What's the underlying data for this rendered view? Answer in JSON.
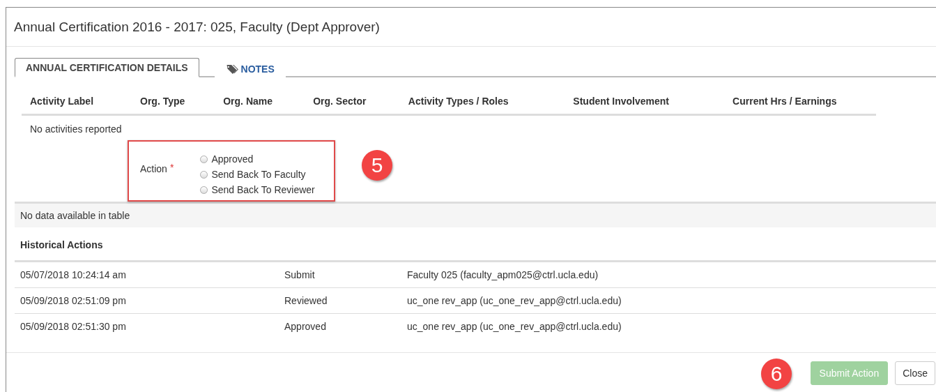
{
  "modal": {
    "title": "Annual Certification 2016 - 2017: 025, Faculty (Dept Approver)"
  },
  "tabs": [
    {
      "label": "ANNUAL CERTIFICATION DETAILS",
      "selected": true
    },
    {
      "label": "NOTES",
      "selected": false
    }
  ],
  "activities_table": {
    "columns": [
      "Activity Label",
      "Org. Type",
      "Org. Name",
      "Org. Sector",
      "Activity Types / Roles",
      "Student Involvement",
      "Current Hrs / Earnings"
    ],
    "empty_message": "No activities reported"
  },
  "action_form": {
    "label": "Action",
    "required_mark": "*",
    "options": [
      {
        "label": "Approved",
        "selected": false
      },
      {
        "label": "Send Back To Faculty",
        "selected": false
      },
      {
        "label": "Send Back To Reviewer",
        "selected": false
      }
    ],
    "callout": "5"
  },
  "no_data_message": "No data available in table",
  "historical_actions": {
    "title": "Historical Actions",
    "rows": [
      {
        "date": "05/07/2018 10:24:14 am",
        "action": "Submit",
        "user": "Faculty 025 (faculty_apm025@ctrl.ucla.edu)"
      },
      {
        "date": "05/09/2018 02:51:09 pm",
        "action": "Reviewed",
        "user": "uc_one rev_app (uc_one_rev_app@ctrl.ucla.edu)"
      },
      {
        "date": "05/09/2018 02:51:30 pm",
        "action": "Approved",
        "user": "uc_one rev_app (uc_one_rev_app@ctrl.ucla.edu)"
      }
    ]
  },
  "footer": {
    "callout": "6",
    "buttons": [
      {
        "label": "Submit Action",
        "kind": "primary",
        "disabled": true
      },
      {
        "label": "Close",
        "kind": "default",
        "disabled": false
      }
    ]
  }
}
